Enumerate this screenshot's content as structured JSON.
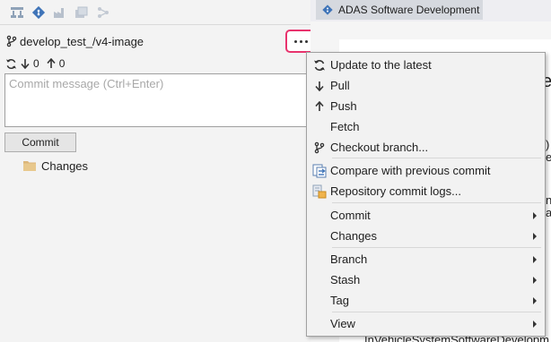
{
  "toolbar": {
    "icons": [
      "branch-graph-icon",
      "git-diamond-icon",
      "factory-icon",
      "stack-icon",
      "network-icon"
    ]
  },
  "repo": {
    "branch": "develop_test_/v4-image",
    "incoming": "0",
    "outgoing": "0"
  },
  "commit": {
    "placeholder": "Commit message (Ctrl+Enter)",
    "button_label": "Commit"
  },
  "tree": {
    "changes_label": "Changes"
  },
  "editor": {
    "tab_title": "ADAS Software Development",
    "bottom_line": "InVehicleSystemSoftwareDevelopm"
  },
  "context_menu": {
    "items": [
      {
        "label": "Update to the latest",
        "icon": "refresh-icon"
      },
      {
        "label": "Pull",
        "icon": "arrow-down-icon"
      },
      {
        "label": "Push",
        "icon": "arrow-up-icon"
      },
      {
        "label": "Fetch",
        "icon": ""
      },
      {
        "label": "Checkout branch...",
        "icon": "branch-icon"
      },
      {
        "label": "Compare with previous commit",
        "icon": "compare-icon"
      },
      {
        "label": "Repository commit logs...",
        "icon": "commit-log-icon"
      },
      {
        "label": "Commit",
        "submenu": true
      },
      {
        "label": "Changes",
        "submenu": true
      },
      {
        "label": "Branch",
        "submenu": true
      },
      {
        "label": "Stash",
        "submenu": true
      },
      {
        "label": "Tag",
        "submenu": true
      },
      {
        "label": "View",
        "submenu": true
      }
    ]
  },
  "colors": {
    "highlight_border": "#e8336d",
    "panel_bg": "#f3f3f3",
    "menu_bg": "#f2f2f2"
  }
}
